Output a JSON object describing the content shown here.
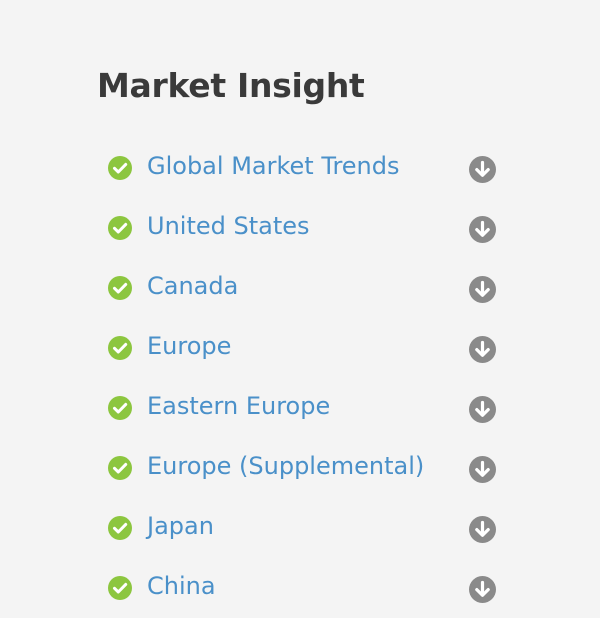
{
  "page": {
    "title": "Market Insight"
  },
  "colors": {
    "background": "#f4f4f4",
    "title": "#3a3a3a",
    "link": "#4a90c9",
    "check": "#8cc63f",
    "download": "#8a8a8a"
  },
  "icons": {
    "status": "check-circle-icon",
    "action": "download-arrow-icon"
  },
  "items": [
    {
      "label": "Global Market Trends"
    },
    {
      "label": "United States"
    },
    {
      "label": "Canada"
    },
    {
      "label": "Europe"
    },
    {
      "label": "Eastern Europe"
    },
    {
      "label": "Europe (Supplemental)"
    },
    {
      "label": "Japan"
    },
    {
      "label": "China"
    }
  ]
}
